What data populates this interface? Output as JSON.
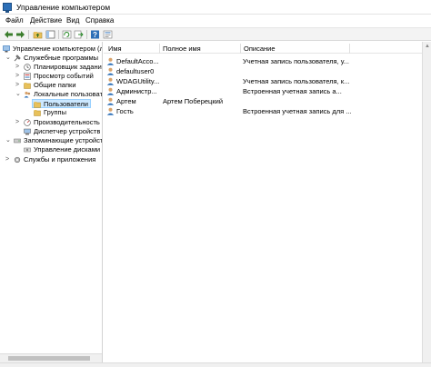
{
  "window": {
    "title": "Управление компьютером"
  },
  "menu": [
    "Файл",
    "Действие",
    "Вид",
    "Справка"
  ],
  "toolbar": {
    "buttons": [
      "back-icon",
      "forward-icon",
      "folder-up-icon",
      "console-tree-icon",
      "refresh-icon",
      "export-icon",
      "help-icon",
      "properties-icon"
    ]
  },
  "tree": {
    "items": [
      {
        "label": "Управление компьютером (л",
        "icon": "computer-management-icon",
        "expander": ""
      },
      {
        "label": "Служебные программы",
        "icon": "tools-icon",
        "expander": "⌄"
      },
      {
        "label": "Планировщик заданий",
        "icon": "task-scheduler-icon",
        "expander": ">"
      },
      {
        "label": "Просмотр событий",
        "icon": "event-viewer-icon",
        "expander": ">"
      },
      {
        "label": "Общие папки",
        "icon": "shared-folders-icon",
        "expander": ">"
      },
      {
        "label": "Локальные пользовате",
        "icon": "local-users-icon",
        "expander": "⌄"
      },
      {
        "label": "Пользователи",
        "icon": "folder-icon",
        "expander": ""
      },
      {
        "label": "Группы",
        "icon": "folder-icon",
        "expander": ""
      },
      {
        "label": "Производительность",
        "icon": "performance-icon",
        "expander": ">"
      },
      {
        "label": "Диспетчер устройств",
        "icon": "device-manager-icon",
        "expander": ""
      },
      {
        "label": "Запоминающие устройст",
        "icon": "storage-icon",
        "expander": "⌄"
      },
      {
        "label": "Управление дисками",
        "icon": "disk-management-icon",
        "expander": ""
      },
      {
        "label": "Службы и приложения",
        "icon": "services-icon",
        "expander": ">"
      }
    ]
  },
  "table": {
    "columns": [
      "Имя",
      "Полное имя",
      "Описание"
    ],
    "rows": [
      {
        "name": "DefaultAcco...",
        "fullname": "",
        "description": "Учетная запись пользователя, у..."
      },
      {
        "name": "defaultuser0",
        "fullname": "",
        "description": ""
      },
      {
        "name": "WDAGUtility...",
        "fullname": "",
        "description": "Учетная запись пользователя, к..."
      },
      {
        "name": "Администр...",
        "fullname": "",
        "description": "Встроенная учетная запись а..."
      },
      {
        "name": "Артем",
        "fullname": "Артем Поберецкий",
        "description": ""
      },
      {
        "name": "Гость",
        "fullname": "",
        "description": "Встроенная учетная запись для ..."
      }
    ]
  },
  "colors": {
    "accent": "#2c6fb7",
    "selection": "#cce8ff",
    "folder": "#e8c15a"
  }
}
